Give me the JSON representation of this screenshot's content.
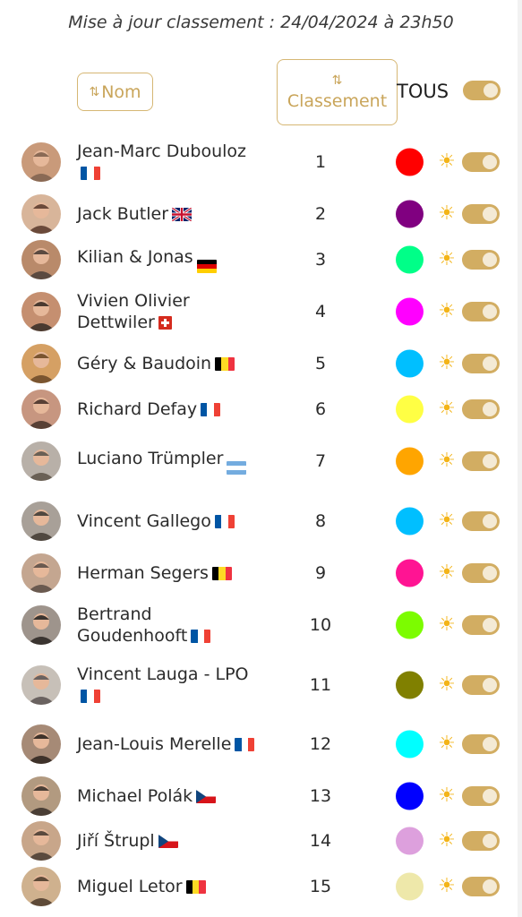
{
  "update_text": "Mise à jour classement : 24/04/2024 à 23h50",
  "header": {
    "sort_name_label": "Nom",
    "sort_rank_label": "Classement",
    "all_label": "TOUS"
  },
  "rows": [
    {
      "name": "Jean-Marc Dubouloz",
      "flag": "fr",
      "rank": "1",
      "color": "#ff0000"
    },
    {
      "name": "Jack Butler",
      "flag": "gb",
      "rank": "2",
      "color": "#800080"
    },
    {
      "name": "Kilian & Jonas",
      "flag": "de",
      "rank": "3",
      "color": "#00ff88"
    },
    {
      "name": "Vivien Olivier Dettwiler",
      "flag": "ch",
      "rank": "4",
      "color": "#ff00ff"
    },
    {
      "name": "Géry & Baudoin",
      "flag": "be",
      "rank": "5",
      "color": "#00bfff"
    },
    {
      "name": "Richard Defay",
      "flag": "fr",
      "rank": "6",
      "color": "#ffff44"
    },
    {
      "name": "Luciano Trümpler",
      "flag": "ar",
      "rank": "7",
      "color": "#ffa500"
    },
    {
      "name": "Vincent Gallego",
      "flag": "fr",
      "rank": "8",
      "color": "#00bfff"
    },
    {
      "name": "Herman Segers",
      "flag": "be",
      "rank": "9",
      "color": "#ff1493"
    },
    {
      "name": "Bertrand Goudenhooft",
      "flag": "fr",
      "rank": "10",
      "color": "#7cfc00"
    },
    {
      "name": "Vincent Lauga - LPO",
      "flag": "fr",
      "rank": "11",
      "color": "#808000"
    },
    {
      "name": "Jean-Louis Merelle",
      "flag": "fr",
      "rank": "12",
      "color": "#00ffff"
    },
    {
      "name": "Michael Polák",
      "flag": "cz",
      "rank": "13",
      "color": "#0000ff"
    },
    {
      "name": "Jiří Štrupl",
      "flag": "cz",
      "rank": "14",
      "color": "#dda0dd"
    },
    {
      "name": "Miguel Letor",
      "flag": "be",
      "rank": "15",
      "color": "#eee8aa"
    }
  ]
}
